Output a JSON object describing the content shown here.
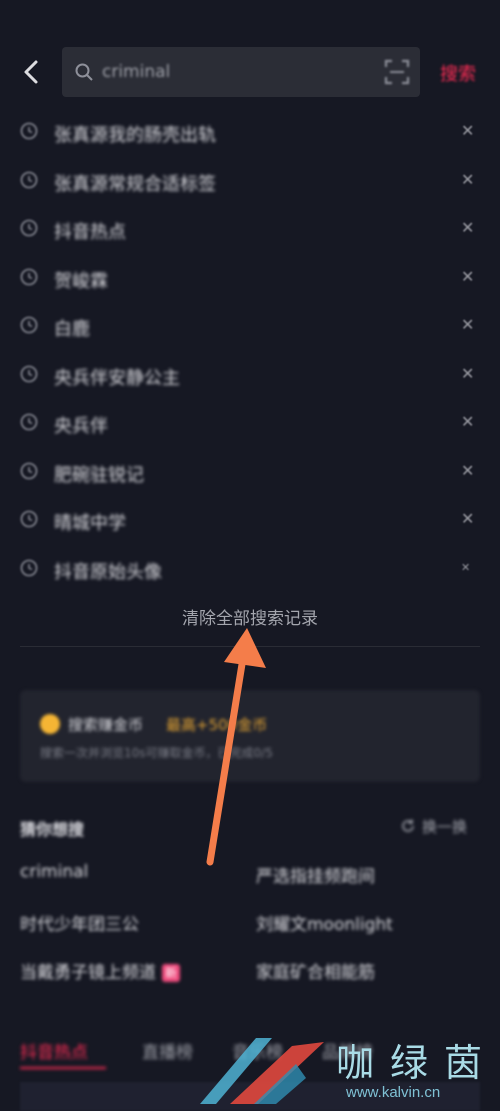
{
  "search": {
    "query": "criminal",
    "button_label": "搜索"
  },
  "history": [
    {
      "text": "张真源我的肠壳出轨"
    },
    {
      "text": "张真源常规合适标签"
    },
    {
      "text": "抖音热点"
    },
    {
      "text": "贺峻霖"
    },
    {
      "text": "白鹿"
    },
    {
      "text": "央兵伴安静公主"
    },
    {
      "text": "央兵伴"
    },
    {
      "text": "肥碗驻锐记"
    },
    {
      "text": "晴城中学"
    },
    {
      "text": "抖音原始头像"
    }
  ],
  "clear_all_label": "清除全部搜索记录",
  "gold_card": {
    "title": "搜索赚金币",
    "highlight": "最高+500金币",
    "subtitle": "搜索一次并浏览10s可赚取金币，已完成0/5"
  },
  "guess": {
    "heading": "猜你想搜",
    "refresh_label": "换一换",
    "items": [
      {
        "text": "criminal"
      },
      {
        "text": "严选指挂频跑间"
      },
      {
        "text": "时代少年团三公"
      },
      {
        "text": "刘耀文moonlight"
      },
      {
        "text": "当戴勇子镜上频道",
        "badge": "新"
      },
      {
        "text": "家庭矿合相能筋"
      }
    ]
  },
  "bottom_tabs": [
    {
      "label": "抖音热点",
      "active": true
    },
    {
      "label": "直播榜",
      "active": false
    },
    {
      "label": "音乐榜",
      "active": false
    },
    {
      "label": "品牌榜",
      "active": false
    }
  ],
  "watermark": {
    "chinese": "咖绿茵",
    "url": "www.kalvin.cn"
  },
  "colors": {
    "background": "#161823",
    "accent": "#fe2c55",
    "annotation_arrow": "#f47d4a",
    "gold": "#f5b534"
  },
  "icons": {
    "back": "chevron-left-icon",
    "search": "search-icon",
    "scan": "scan-icon",
    "history": "clock-icon",
    "delete": "close-icon",
    "refresh": "refresh-icon"
  }
}
